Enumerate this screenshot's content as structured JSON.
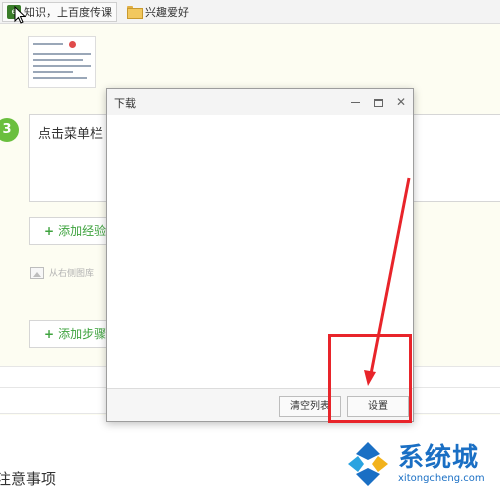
{
  "bookmarks": {
    "item1_icon_text": "e",
    "item1_label": "知识，上百度传课",
    "folder_label": "兴趣爱好"
  },
  "content": {
    "step_number": "3",
    "step_text": "点击菜单栏",
    "add_experience_label": "添加经验",
    "image_hint": "从右侧图库",
    "add_step_label": "添加步骤",
    "notes_title": "注意事项"
  },
  "dialog": {
    "title": "下载",
    "clear_list_label": "清空列表",
    "settings_label": "设置",
    "close_glyph": "✕"
  },
  "watermark": {
    "name": "系统城",
    "url": "xitongcheng.com"
  },
  "colors": {
    "accent_green": "#6abf3e",
    "annotation_red": "#e8242a",
    "watermark_blue": "#1a6fc4"
  }
}
